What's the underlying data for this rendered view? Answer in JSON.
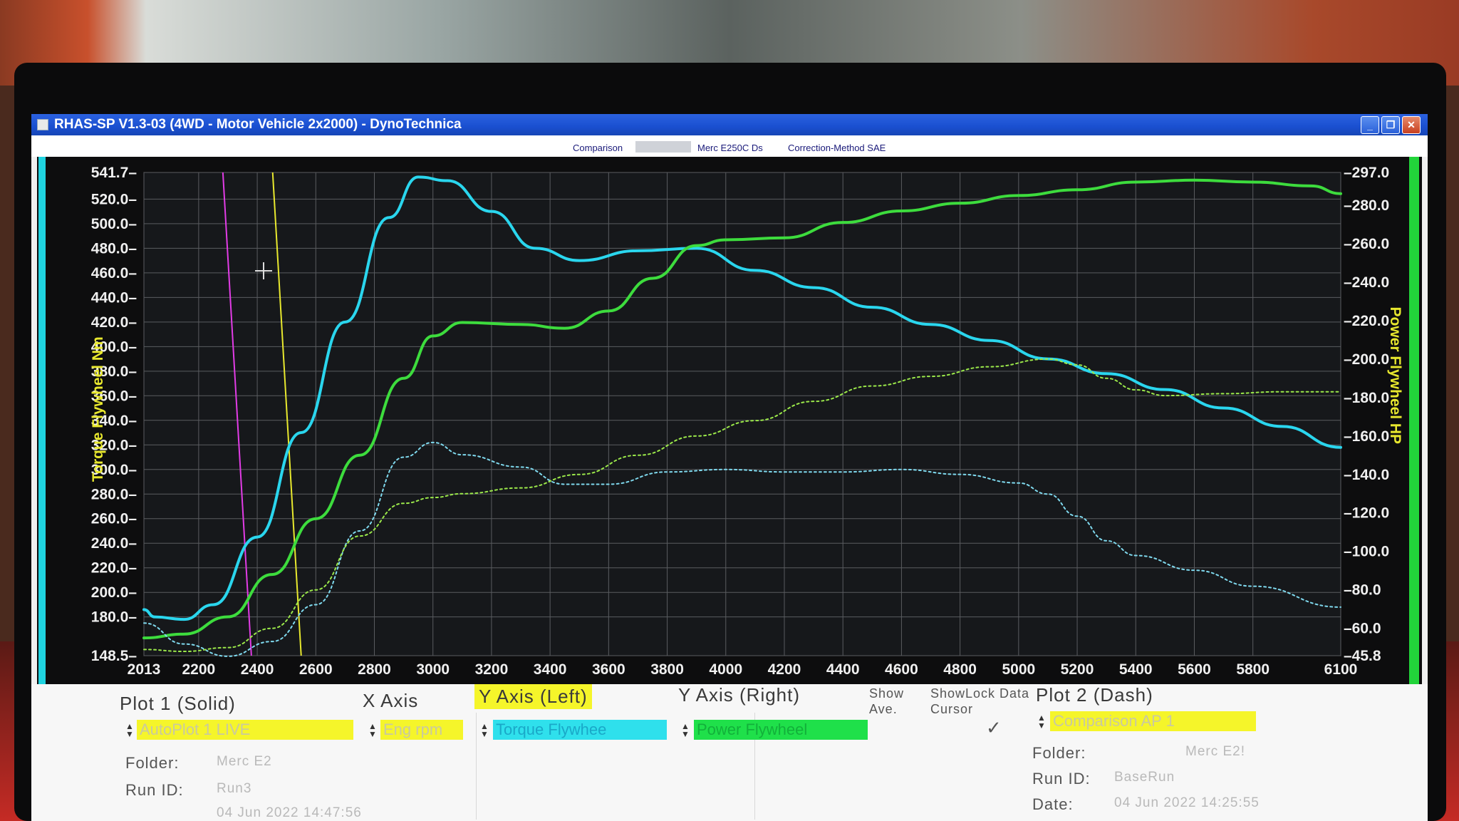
{
  "window": {
    "title": "RHAS-SP V1.3-03  (4WD - Motor Vehicle 2x2000) - DynoTechnica"
  },
  "info": {
    "comparison_label": "Comparison",
    "vehicle": "Merc E250C Ds",
    "correction": "Correction-Method SAE"
  },
  "chart_data": {
    "type": "line",
    "x_ticks": [
      "2013",
      "2200",
      "2400",
      "2600",
      "2800",
      "3000",
      "3200",
      "3400",
      "3600",
      "3800",
      "4000",
      "4200",
      "4400",
      "4600",
      "4800",
      "5000",
      "5200",
      "5400",
      "5600",
      "5800",
      "6100"
    ],
    "xlim": [
      2013,
      6100
    ],
    "left_axis": {
      "label": "Torque Flywheel Nm",
      "range": [
        148.5,
        541.7
      ],
      "ticks": [
        "541.7",
        "520.0",
        "500.0",
        "480.0",
        "460.0",
        "440.0",
        "420.0",
        "400.0",
        "380.0",
        "360.0",
        "340.0",
        "320.0",
        "300.0",
        "280.0",
        "260.0",
        "240.0",
        "220.0",
        "200.0",
        "180.0",
        "148.5"
      ]
    },
    "right_axis": {
      "label": "Power Flywheel HP",
      "range": [
        45.8,
        297.0
      ],
      "ticks": [
        "297.0",
        "280.0",
        "260.0",
        "240.0",
        "220.0",
        "200.0",
        "180.0",
        "160.0",
        "140.0",
        "120.0",
        "100.0",
        "80.0",
        "60.0",
        "45.8"
      ]
    },
    "cursor_lines": [
      {
        "color": "#e23ce6",
        "rpm": 2380
      },
      {
        "color": "#e8e82e",
        "rpm": 2550
      }
    ],
    "series": [
      {
        "axis": "left",
        "color": "#2ad6ee",
        "style": "solid",
        "x": [
          2013,
          2050,
          2150,
          2250,
          2400,
          2550,
          2700,
          2850,
          2950,
          3050,
          3200,
          3350,
          3500,
          3700,
          3900,
          4100,
          4300,
          4500,
          4700,
          4900,
          5100,
          5300,
          5500,
          5700,
          5900,
          6100
        ],
        "y": [
          186,
          180,
          178,
          190,
          245,
          330,
          420,
          505,
          538,
          535,
          510,
          480,
          470,
          478,
          480,
          462,
          448,
          432,
          418,
          405,
          390,
          378,
          365,
          350,
          335,
          318
        ]
      },
      {
        "axis": "right",
        "color": "#3ddc3d",
        "style": "solid",
        "x": [
          2013,
          2150,
          2300,
          2450,
          2600,
          2750,
          2900,
          3000,
          3100,
          3300,
          3450,
          3600,
          3750,
          3900,
          4000,
          4200,
          4400,
          4600,
          4800,
          5000,
          5200,
          5400,
          5600,
          5800,
          6000,
          6100
        ],
        "y": [
          55,
          57,
          66,
          88,
          117,
          150,
          190,
          212,
          219,
          218,
          216,
          225,
          242,
          259,
          262,
          263,
          271,
          277,
          281,
          285,
          288,
          292,
          293,
          292,
          290,
          286
        ]
      },
      {
        "axis": "left",
        "color": "#7fd9ee",
        "style": "dotted",
        "x": [
          2013,
          2150,
          2300,
          2450,
          2600,
          2750,
          2900,
          3000,
          3100,
          3300,
          3450,
          3600,
          3800,
          4000,
          4200,
          4400,
          4600,
          4800,
          5000,
          5100,
          5200,
          5300,
          5400,
          5600,
          5800,
          6100
        ],
        "y": [
          175,
          158,
          148,
          160,
          190,
          250,
          310,
          322,
          312,
          302,
          288,
          288,
          298,
          300,
          298,
          298,
          300,
          296,
          289,
          280,
          262,
          242,
          230,
          218,
          205,
          188
        ]
      },
      {
        "axis": "right",
        "color": "#9be84a",
        "style": "dotted",
        "x": [
          2013,
          2150,
          2300,
          2450,
          2600,
          2750,
          2900,
          3000,
          3100,
          3300,
          3500,
          3700,
          3900,
          4100,
          4300,
          4500,
          4700,
          4900,
          5100,
          5200,
          5300,
          5400,
          5500,
          5700,
          5900,
          6100
        ],
        "y": [
          49,
          48,
          50,
          60,
          80,
          108,
          125,
          128,
          130,
          133,
          140,
          150,
          160,
          168,
          178,
          186,
          191,
          196,
          200,
          197,
          190,
          184,
          181,
          182,
          183,
          183
        ]
      }
    ]
  },
  "controls": {
    "plot1_label": "Plot 1 (Solid)",
    "plot1_value": "AutoPlot 1 LIVE",
    "x_axis_label": "X Axis",
    "x_axis_value": "Eng rpm",
    "y_left_label": "Y Axis (Left)",
    "y_left_value": "Torque Flywhee",
    "y_right_label": "Y Axis (Right)",
    "y_right_value": "Power Flywheel",
    "show_ave_label": "Show Ave.",
    "showlock_label": "ShowLock Data Cursor",
    "check_mark": "✓",
    "plot2_label": "Plot 2 (Dash)",
    "plot2_value": "Comparison AP 1",
    "folder_label": "Folder:",
    "folder_value_left": "Merc E2",
    "runid_label": "Run ID:",
    "runid_value_left": "Run3",
    "date_value_left": "04 Jun 2022  14:47:56",
    "folder_value_right": "Merc E2!",
    "runid_value_right": "BaseRun",
    "date_label": "Date:",
    "date_value_right": "04 Jun 2022  14:25:55"
  }
}
